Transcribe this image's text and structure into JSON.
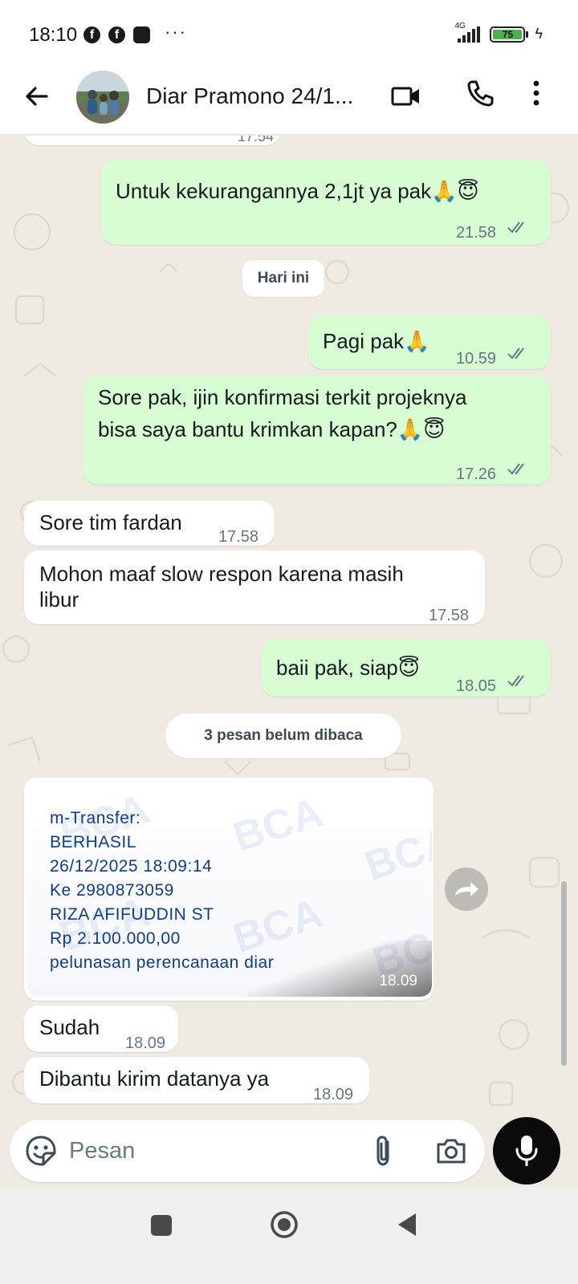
{
  "status_bar": {
    "time": "18:10",
    "network": "4G",
    "battery_level": "75",
    "icons": [
      "facebook-icon",
      "facebook-icon",
      "app-icon",
      "more-dots-icon",
      "signal-icon",
      "battery-icon",
      "charging-icon"
    ]
  },
  "header": {
    "contact_name": "Diar Pramono 24/1...",
    "icons": [
      "back-arrow-icon",
      "video-call-icon",
      "phone-icon",
      "more-vertical-icon"
    ]
  },
  "chat": {
    "partial_time": "17.54",
    "messages": [
      {
        "direction": "out",
        "text": "Untuk kekurangannya 2,1jt ya pak",
        "emoji": "🙏😇",
        "time": "21.58",
        "status": "read"
      },
      {
        "type": "date-divider",
        "text": "Hari ini"
      },
      {
        "direction": "out",
        "text": "Pagi pak",
        "emoji": "🙏",
        "time": "10.59",
        "status": "read"
      },
      {
        "direction": "out",
        "text_line1": "Sore pak, ijin konfirmasi terkit projeknya",
        "text_line2": "bisa saya bantu krimkan kapan?",
        "emoji": "🙏😇",
        "time": "17.26",
        "status": "read"
      },
      {
        "direction": "in",
        "text": "Sore tim fardan",
        "time": "17.58"
      },
      {
        "direction": "in",
        "text_line1": "Mohon maaf slow respon karena masih",
        "text_line2": "libur",
        "time": "17.58"
      },
      {
        "direction": "out",
        "text": "baii pak, siap",
        "emoji": "😇",
        "time": "18.05",
        "status": "read"
      },
      {
        "type": "unread-divider",
        "text": "3 pesan belum dibaca"
      },
      {
        "direction": "in",
        "type": "image",
        "receipt_lines": [
          "m-Transfer:",
          "BERHASIL",
          "26/12/2025 18:09:14",
          "Ke 2980873059",
          "RIZA AFIFUDDIN ST",
          "Rp 2.100.000,00",
          "pelunasan perencanaan diar"
        ],
        "watermark": "BCA",
        "time": "18.09"
      },
      {
        "direction": "in",
        "text": "Sudah",
        "time": "18.09"
      },
      {
        "direction": "in",
        "text": "Dibantu kirim datanya ya",
        "time": "18.09"
      }
    ]
  },
  "input_bar": {
    "placeholder": "Pesan",
    "icons": [
      "emoji-sticker-icon",
      "paperclip-icon",
      "camera-icon",
      "microphone-icon"
    ]
  },
  "nav_bar": {
    "icons": [
      "recent-apps-icon",
      "home-icon",
      "back-triangle-icon"
    ]
  },
  "colors": {
    "outgoing_bubble": "#d9fdd3",
    "incoming_bubble": "#ffffff",
    "chat_background": "#efeae2",
    "read_ticks": "#667781",
    "receipt_text": "#0e3c8a"
  }
}
